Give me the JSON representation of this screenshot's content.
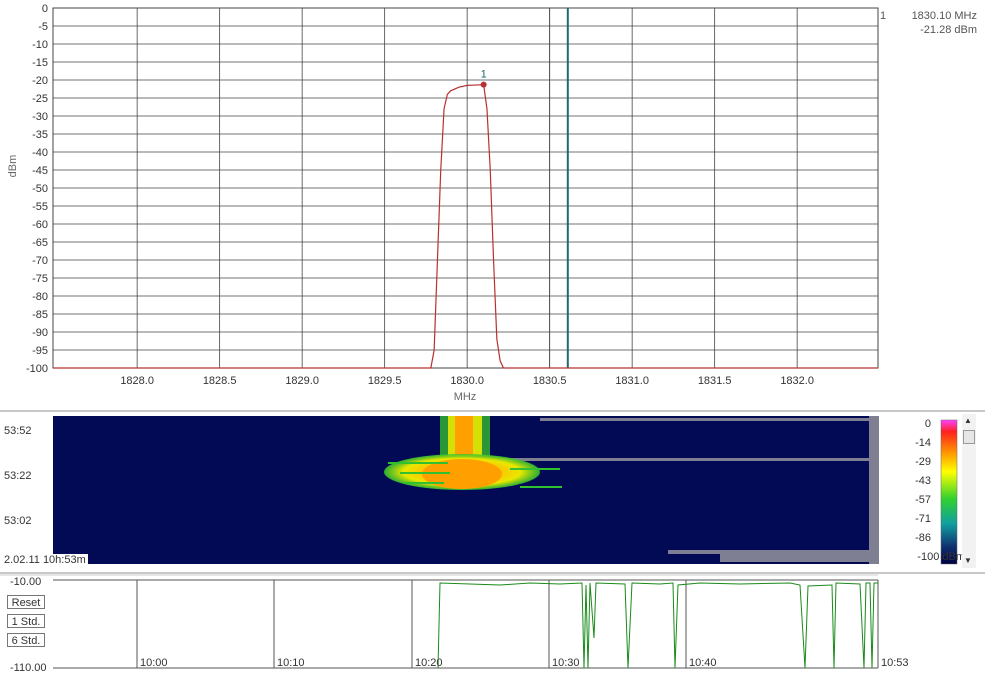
{
  "spectrum": {
    "ylabel": "dBm",
    "xlabel": "MHz",
    "y_ticks": [
      "0",
      "-5",
      "-10",
      "-15",
      "-20",
      "-25",
      "-30",
      "-35",
      "-40",
      "-45",
      "-50",
      "-55",
      "-60",
      "-65",
      "-70",
      "-75",
      "-80",
      "-85",
      "-90",
      "-95",
      "-100"
    ],
    "x_ticks": [
      "1828.0",
      "1828.5",
      "1829.0",
      "1829.5",
      "1830.0",
      "1830.5",
      "1831.0",
      "1831.5",
      "1832.0"
    ],
    "marker": {
      "index": "1",
      "freq": "1830.10 MHz",
      "amp": "-21.28 dBm"
    },
    "colors": {
      "trace": "#b83030",
      "cursor": "#1f6b6b",
      "grid": "#444444"
    }
  },
  "chart_data": {
    "type": "line",
    "xlabel": "MHz",
    "ylabel": "dBm",
    "xlim": [
      1827.49,
      1832.49
    ],
    "ylim": [
      -100,
      0
    ],
    "cursor_x": 1830.61,
    "marker": {
      "label": "1",
      "x": 1830.1,
      "y": -21.28
    },
    "series": [
      {
        "x": [
          1827.49,
          1829.78,
          1829.8,
          1829.82,
          1829.84,
          1829.86,
          1829.88,
          1829.9,
          1829.95,
          1830.0,
          1830.05,
          1830.1,
          1830.12,
          1830.14,
          1830.16,
          1830.18,
          1830.2,
          1830.22,
          1832.49
        ],
        "y": [
          -100,
          -100,
          -95,
          -70,
          -45,
          -28,
          -24,
          -23,
          -22,
          -21.5,
          -21.4,
          -21.28,
          -28,
          -45,
          -70,
          -92,
          -98,
          -100,
          -100
        ]
      }
    ]
  },
  "waterfall": {
    "times": [
      "53:52",
      "53:22",
      "53:02"
    ],
    "timestamp": "2.02.11 10h:53m",
    "scale": [
      "0",
      "-14",
      "-29",
      "-43",
      "-57",
      "-71",
      "-86",
      "-100 dBm"
    ]
  },
  "history": {
    "y_top": "-10.00",
    "y_bottom": "-110.00",
    "buttons": [
      "Reset",
      "1 Std.",
      "6 Std."
    ],
    "x_ticks": [
      "10:00",
      "10:10",
      "10:20",
      "10:30",
      "10:40",
      "10:53"
    ],
    "colors": {
      "trace": "#1a8a1a"
    }
  }
}
